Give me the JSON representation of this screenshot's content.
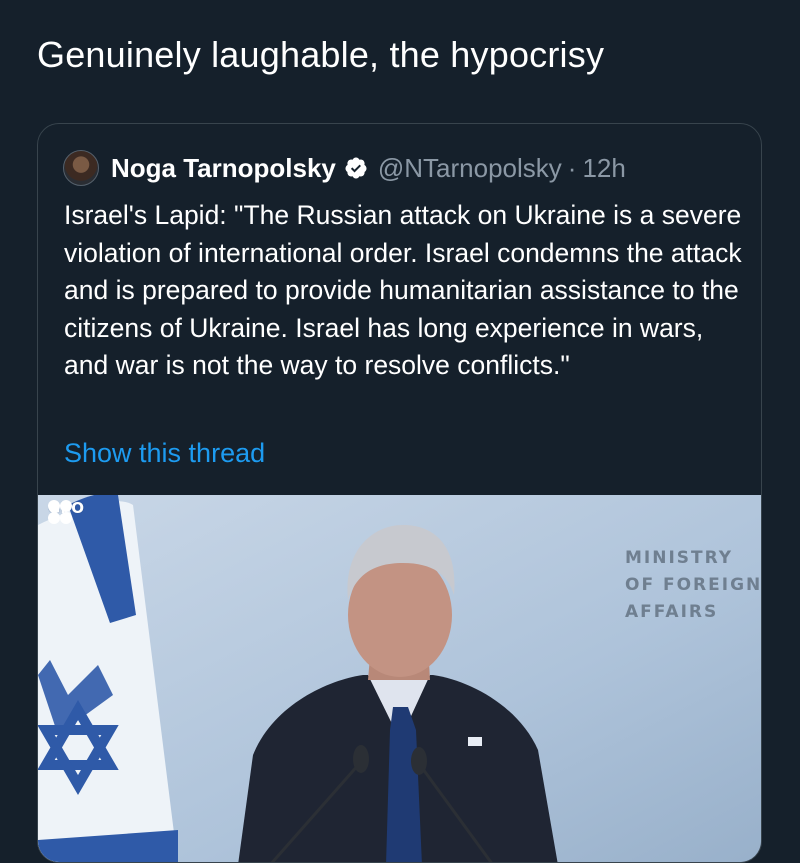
{
  "tweet": {
    "text": "Genuinely laughable, the hypocrisy"
  },
  "quoted_tweet": {
    "author_name": "Noga Tarnopolsky",
    "handle": "@NTarnopolsky",
    "separator": "·",
    "time": "12h",
    "body": "Israel's Lapid: \"The Russian attack on Ukraine is a severe violation of international order. Israel condemns the attack and is prepared to provide humanitarian assistance to the citizens of Ukraine. Israel has long experience in wars, and war is not the way to resolve conflicts.\"",
    "show_thread_label": "Show this thread",
    "media": {
      "backdrop_text": "MINISTRY\nOF FOREIGN\nAFFAIRS",
      "watermark_text": "GPO"
    }
  },
  "colors": {
    "background": "#15202b",
    "link": "#1d9bf0",
    "secondary_text": "#8b98a5",
    "border": "#38444d"
  },
  "icons": [
    "avatar",
    "verified-badge-icon",
    "gpo-logo-icon",
    "flag-of-israel"
  ]
}
